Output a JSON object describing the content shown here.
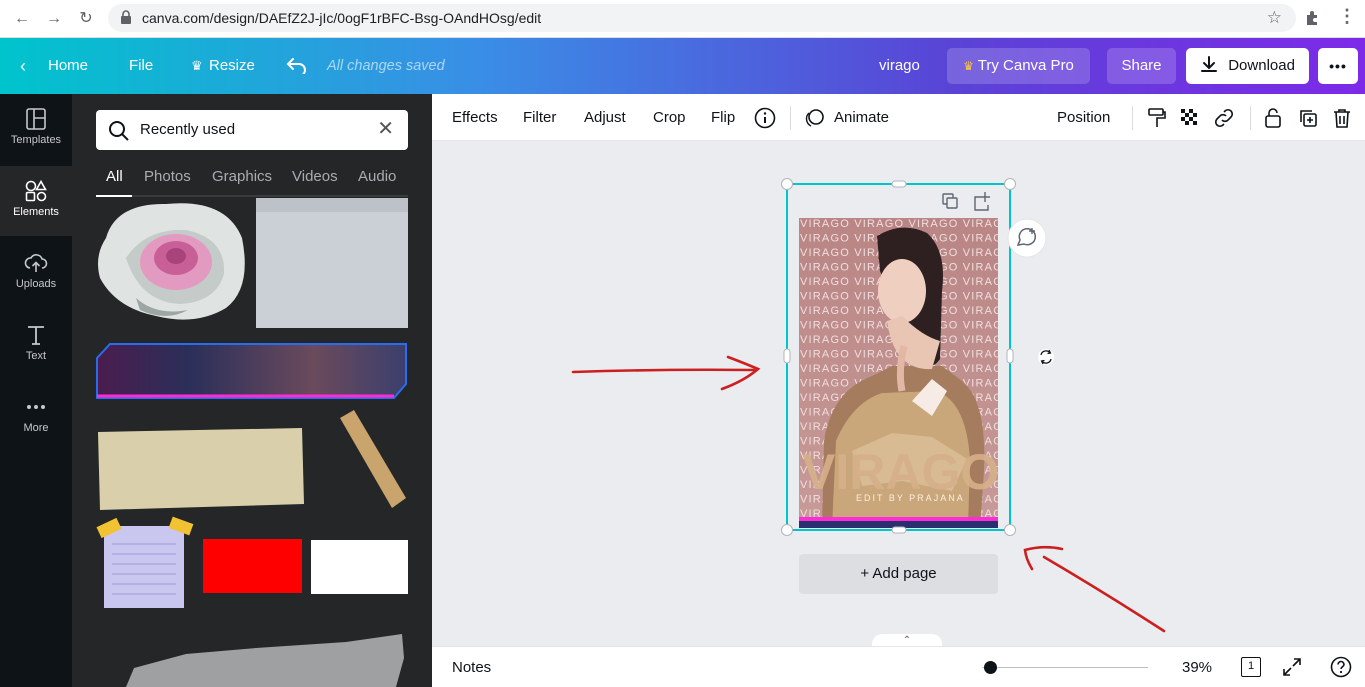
{
  "browser": {
    "url": "canva.com/design/DAEfZ2J-jIc/0ogF1rBFC-Bsg-OAndHOsg/edit"
  },
  "topbar": {
    "home": "Home",
    "file": "File",
    "resize": "Resize",
    "status": "All changes saved",
    "design_name": "virago",
    "try_pro": "Try Canva Pro",
    "share": "Share",
    "download": "Download",
    "more": "•••"
  },
  "sidebar": {
    "items": [
      {
        "label": "Templates",
        "icon": "templates-icon"
      },
      {
        "label": "Elements",
        "icon": "elements-icon"
      },
      {
        "label": "Uploads",
        "icon": "uploads-icon"
      },
      {
        "label": "Text",
        "icon": "text-icon"
      },
      {
        "label": "More",
        "icon": "more-icon"
      }
    ],
    "active": "Elements"
  },
  "panel": {
    "search_value": "Recently used",
    "tabs": [
      "All",
      "Photos",
      "Graphics",
      "Videos",
      "Audio"
    ],
    "active_tab": "All"
  },
  "toolbar": {
    "effects": "Effects",
    "filter": "Filter",
    "adjust": "Adjust",
    "crop": "Crop",
    "flip": "Flip",
    "animate": "Animate",
    "position": "Position"
  },
  "design": {
    "pattern_word": "VIRAGO",
    "title": "VIRAGO",
    "subtitle": "EDIT BY PRAJANA"
  },
  "canvas": {
    "add_page": "+ Add page"
  },
  "footer": {
    "notes": "Notes",
    "zoom": "39%",
    "page_count": "1",
    "zoom_level": 0.39
  },
  "colors": {
    "accent": "#00c4cc",
    "gradient_end": "#7d2ae8",
    "annotation_arrow": "#cc1f1f"
  }
}
